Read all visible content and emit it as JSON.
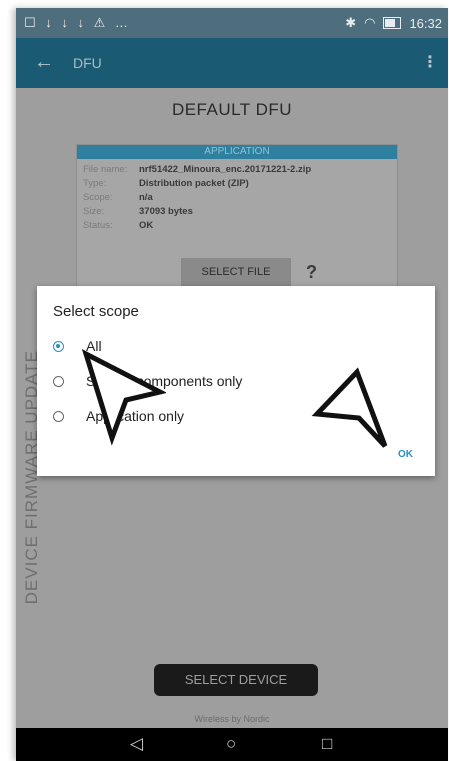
{
  "status_bar": {
    "left_icons": "☐ ↓ ↓ ↓ ⚠ …",
    "time": "16:32"
  },
  "app_bar": {
    "title": "DFU",
    "back_icon": "arrow-back-icon",
    "menu_icon": "overflow-menu-icon"
  },
  "main": {
    "title": "DEFAULT DFU",
    "vertical_label": "DEVICE FIRMWARE UPDATE",
    "application_panel": {
      "header": "APPLICATION",
      "rows": [
        {
          "key": "File name:",
          "value": "nrf51422_Minoura_enc.20171221-2.zip"
        },
        {
          "key": "Type:",
          "value": "Distribution packet (ZIP)"
        },
        {
          "key": "Scope:",
          "value": "n/a"
        },
        {
          "key": "Size:",
          "value": "37093 bytes"
        },
        {
          "key": "Status:",
          "value": "OK"
        }
      ]
    },
    "select_file_label": "SELECT FILE",
    "help_label": "?",
    "select_device_label": "SELECT DEVICE",
    "footer": "Wireless by Nordic"
  },
  "dialog": {
    "title": "Select scope",
    "options": [
      {
        "label": "All",
        "checked": true
      },
      {
        "label": "System components only",
        "checked": false
      },
      {
        "label": "Application only",
        "checked": false
      }
    ],
    "ok_label": "OK"
  },
  "nav_bar": {
    "back": "◁",
    "home": "○",
    "recents": "□"
  },
  "colors": {
    "status_bar": "#4e6e7e",
    "app_bar": "#1a5b73",
    "dim_background": "#9e9e9e",
    "accent": "#2b8ec2"
  }
}
